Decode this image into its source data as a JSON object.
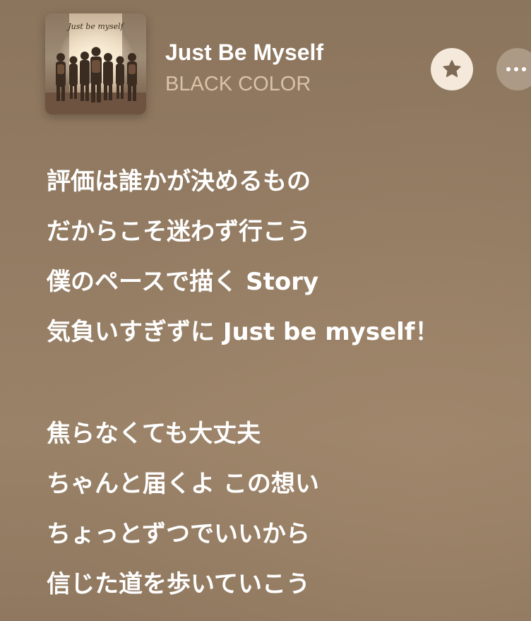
{
  "album_art": {
    "title_text": "Just be myself"
  },
  "track": {
    "title": "Just Be Myself",
    "artist": "BLACK COLOR"
  },
  "icons": {
    "favorite": "star-icon",
    "more": "ellipsis-icon"
  },
  "lyrics": {
    "stanza1": [
      "評価は誰かが決めるもの",
      "だからこそ迷わず行こう",
      "僕のペースで描く Story",
      "気負いすぎずに Just be myself！"
    ],
    "stanza2": [
      "焦らなくても大丈夫",
      "ちゃんと届くよ この想い",
      "ちょっとずつでいいから",
      "信じた道を歩いていこう"
    ]
  },
  "colors": {
    "background": "#927b62",
    "title": "#ffffff",
    "artist": "#d9c3a6",
    "star_button": "#f4e9da",
    "star_icon": "#7e6a55"
  }
}
